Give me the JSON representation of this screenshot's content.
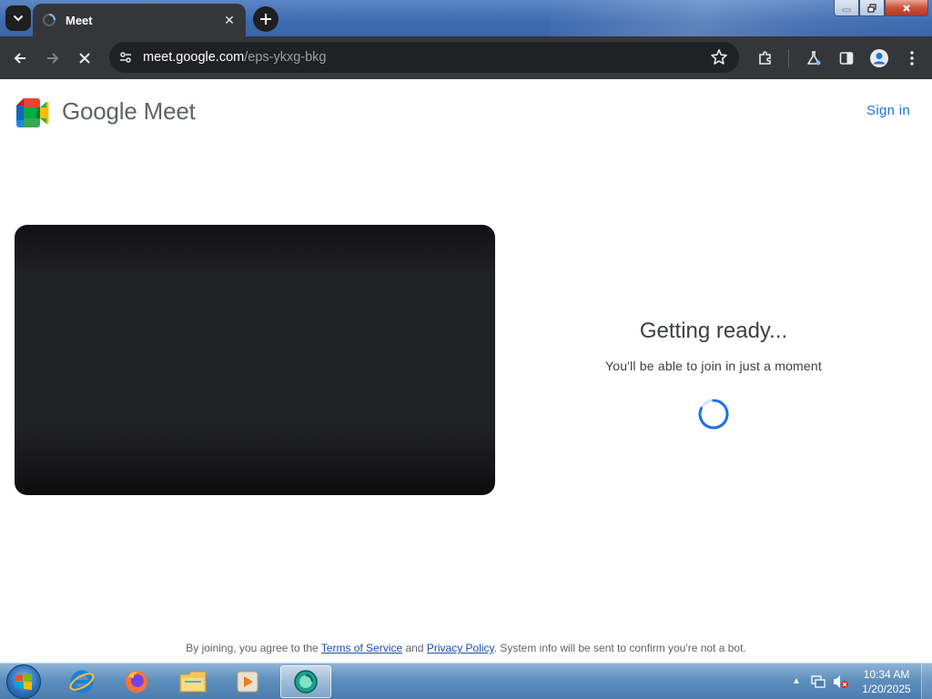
{
  "browser": {
    "tab": {
      "title": "Meet",
      "favicon": "loading-spinner-icon"
    },
    "url": {
      "host": "meet.google.com",
      "path": "/eps-ykxg-bkg"
    }
  },
  "page": {
    "brand": {
      "wordmark": "Google Meet"
    },
    "sign_in": "Sign in",
    "status": {
      "title": "Getting ready...",
      "subtitle": "You'll be able to join in just a moment"
    },
    "footer": {
      "prefix": "By joining, you agree to the ",
      "terms": "Terms of Service",
      "middle": " and ",
      "privacy": "Privacy Policy",
      "suffix": ". System info will be sent to confirm you're not a bot."
    }
  },
  "taskbar": {
    "apps": [
      "internet-explorer-icon",
      "firefox-icon",
      "file-explorer-icon",
      "media-player-icon",
      "meet-app-icon"
    ],
    "clock": {
      "time": "10:34 AM",
      "date": "1/20/2025"
    }
  },
  "colors": {
    "accent": "#1a73e8",
    "toolbar": "#35363a",
    "video_bg": "#202124"
  }
}
